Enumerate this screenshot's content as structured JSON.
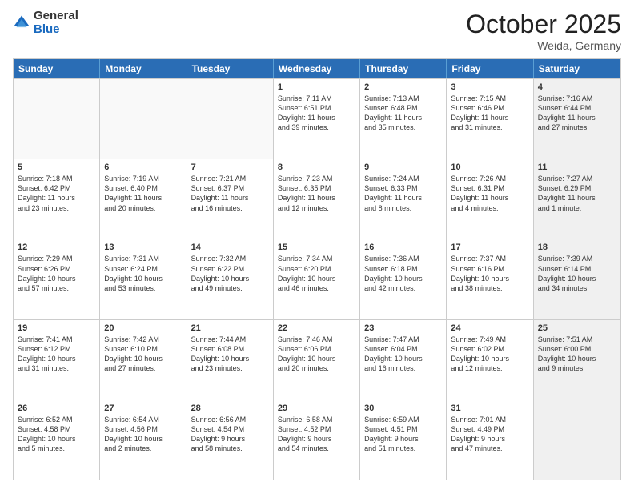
{
  "header": {
    "logo_general": "General",
    "logo_blue": "Blue",
    "title": "October 2025",
    "location": "Weida, Germany"
  },
  "days_of_week": [
    "Sunday",
    "Monday",
    "Tuesday",
    "Wednesday",
    "Thursday",
    "Friday",
    "Saturday"
  ],
  "rows": [
    [
      {
        "day": "",
        "text": "",
        "empty": true
      },
      {
        "day": "",
        "text": "",
        "empty": true
      },
      {
        "day": "",
        "text": "",
        "empty": true
      },
      {
        "day": "1",
        "text": "Sunrise: 7:11 AM\nSunset: 6:51 PM\nDaylight: 11 hours\nand 39 minutes."
      },
      {
        "day": "2",
        "text": "Sunrise: 7:13 AM\nSunset: 6:48 PM\nDaylight: 11 hours\nand 35 minutes."
      },
      {
        "day": "3",
        "text": "Sunrise: 7:15 AM\nSunset: 6:46 PM\nDaylight: 11 hours\nand 31 minutes."
      },
      {
        "day": "4",
        "text": "Sunrise: 7:16 AM\nSunset: 6:44 PM\nDaylight: 11 hours\nand 27 minutes.",
        "shaded": true
      }
    ],
    [
      {
        "day": "5",
        "text": "Sunrise: 7:18 AM\nSunset: 6:42 PM\nDaylight: 11 hours\nand 23 minutes."
      },
      {
        "day": "6",
        "text": "Sunrise: 7:19 AM\nSunset: 6:40 PM\nDaylight: 11 hours\nand 20 minutes."
      },
      {
        "day": "7",
        "text": "Sunrise: 7:21 AM\nSunset: 6:37 PM\nDaylight: 11 hours\nand 16 minutes."
      },
      {
        "day": "8",
        "text": "Sunrise: 7:23 AM\nSunset: 6:35 PM\nDaylight: 11 hours\nand 12 minutes."
      },
      {
        "day": "9",
        "text": "Sunrise: 7:24 AM\nSunset: 6:33 PM\nDaylight: 11 hours\nand 8 minutes."
      },
      {
        "day": "10",
        "text": "Sunrise: 7:26 AM\nSunset: 6:31 PM\nDaylight: 11 hours\nand 4 minutes."
      },
      {
        "day": "11",
        "text": "Sunrise: 7:27 AM\nSunset: 6:29 PM\nDaylight: 11 hours\nand 1 minute.",
        "shaded": true
      }
    ],
    [
      {
        "day": "12",
        "text": "Sunrise: 7:29 AM\nSunset: 6:26 PM\nDaylight: 10 hours\nand 57 minutes."
      },
      {
        "day": "13",
        "text": "Sunrise: 7:31 AM\nSunset: 6:24 PM\nDaylight: 10 hours\nand 53 minutes."
      },
      {
        "day": "14",
        "text": "Sunrise: 7:32 AM\nSunset: 6:22 PM\nDaylight: 10 hours\nand 49 minutes."
      },
      {
        "day": "15",
        "text": "Sunrise: 7:34 AM\nSunset: 6:20 PM\nDaylight: 10 hours\nand 46 minutes."
      },
      {
        "day": "16",
        "text": "Sunrise: 7:36 AM\nSunset: 6:18 PM\nDaylight: 10 hours\nand 42 minutes."
      },
      {
        "day": "17",
        "text": "Sunrise: 7:37 AM\nSunset: 6:16 PM\nDaylight: 10 hours\nand 38 minutes."
      },
      {
        "day": "18",
        "text": "Sunrise: 7:39 AM\nSunset: 6:14 PM\nDaylight: 10 hours\nand 34 minutes.",
        "shaded": true
      }
    ],
    [
      {
        "day": "19",
        "text": "Sunrise: 7:41 AM\nSunset: 6:12 PM\nDaylight: 10 hours\nand 31 minutes."
      },
      {
        "day": "20",
        "text": "Sunrise: 7:42 AM\nSunset: 6:10 PM\nDaylight: 10 hours\nand 27 minutes."
      },
      {
        "day": "21",
        "text": "Sunrise: 7:44 AM\nSunset: 6:08 PM\nDaylight: 10 hours\nand 23 minutes."
      },
      {
        "day": "22",
        "text": "Sunrise: 7:46 AM\nSunset: 6:06 PM\nDaylight: 10 hours\nand 20 minutes."
      },
      {
        "day": "23",
        "text": "Sunrise: 7:47 AM\nSunset: 6:04 PM\nDaylight: 10 hours\nand 16 minutes."
      },
      {
        "day": "24",
        "text": "Sunrise: 7:49 AM\nSunset: 6:02 PM\nDaylight: 10 hours\nand 12 minutes."
      },
      {
        "day": "25",
        "text": "Sunrise: 7:51 AM\nSunset: 6:00 PM\nDaylight: 10 hours\nand 9 minutes.",
        "shaded": true
      }
    ],
    [
      {
        "day": "26",
        "text": "Sunrise: 6:52 AM\nSunset: 4:58 PM\nDaylight: 10 hours\nand 5 minutes."
      },
      {
        "day": "27",
        "text": "Sunrise: 6:54 AM\nSunset: 4:56 PM\nDaylight: 10 hours\nand 2 minutes."
      },
      {
        "day": "28",
        "text": "Sunrise: 6:56 AM\nSunset: 4:54 PM\nDaylight: 9 hours\nand 58 minutes."
      },
      {
        "day": "29",
        "text": "Sunrise: 6:58 AM\nSunset: 4:52 PM\nDaylight: 9 hours\nand 54 minutes."
      },
      {
        "day": "30",
        "text": "Sunrise: 6:59 AM\nSunset: 4:51 PM\nDaylight: 9 hours\nand 51 minutes."
      },
      {
        "day": "31",
        "text": "Sunrise: 7:01 AM\nSunset: 4:49 PM\nDaylight: 9 hours\nand 47 minutes."
      },
      {
        "day": "",
        "text": "",
        "empty": true,
        "shaded": true
      }
    ]
  ]
}
